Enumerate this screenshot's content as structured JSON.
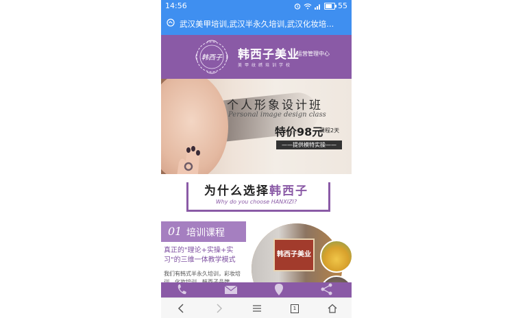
{
  "status_bar": {
    "time": "14:56",
    "battery": "55"
  },
  "url_bar": {
    "title": "武汉美甲培训,武汉半永久培训,武汉化妆培..."
  },
  "brand": {
    "name": "韩西子美业",
    "management": "运营管理中心",
    "subtitle": "美甲纹绣培训学校",
    "logo_text": "韩西子"
  },
  "banner": {
    "course": "个人形象设计班",
    "english": "Personal image design class",
    "price": "特价98元",
    "days": "课程2天",
    "model": "——提供模特实操——"
  },
  "why": {
    "title_prefix": "为什么选择",
    "title_highlight": "韩西子",
    "english": "Why do you choose HANXIZI?"
  },
  "training": {
    "number": "01",
    "label": "培训课程",
    "headline": "真正的\"理论+实操+实习\"的三维一体教学模式",
    "body": "我们有韩式半永久培训，彩妆培训，化妆培训，韩西子品牌",
    "sign_text": "韩西子美业"
  },
  "bottom_nav": {
    "tab_count": "1"
  },
  "colors": {
    "accent_purple": "#8a5aa6",
    "browser_blue": "#3f8ff0"
  }
}
